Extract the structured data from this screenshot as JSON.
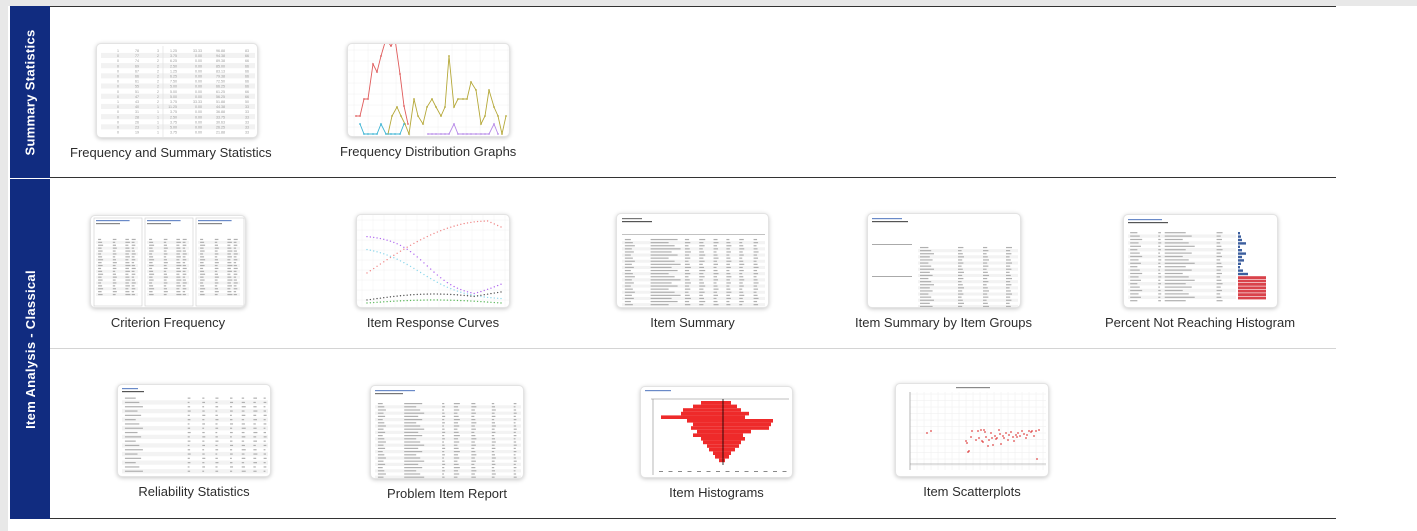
{
  "sections": [
    {
      "label": "Summary Statistics",
      "tiles": [
        {
          "label": "Frequency and Summary Statistics",
          "thumbnail": "frequency-table"
        },
        {
          "label": "Frequency Distribution Graphs",
          "thumbnail": "line-chart"
        }
      ]
    },
    {
      "label": "Item Analysis - Classical",
      "tiles": [
        {
          "label": "Criterion Frequency",
          "thumbnail": "three-panel-table"
        },
        {
          "label": "Item Response Curves",
          "thumbnail": "curve-chart"
        },
        {
          "label": "Item Summary",
          "thumbnail": "table"
        },
        {
          "label": "Item Summary by Item Groups",
          "thumbnail": "grouped-table"
        },
        {
          "label": "Percent Not Reaching Histogram",
          "thumbnail": "bar-table"
        },
        {
          "label": "Reliability Statistics",
          "thumbnail": "table"
        },
        {
          "label": "Problem Item Report",
          "thumbnail": "table"
        },
        {
          "label": "Item Histograms",
          "thumbnail": "histogram"
        },
        {
          "label": "Item Scatterplots",
          "thumbnail": "scatterplot"
        }
      ]
    }
  ],
  "thumbnails": {
    "frequency_table_rows": [
      [
        "1",
        "78",
        "3",
        "1.25",
        "33.33",
        "96.88",
        "83"
      ],
      [
        "0",
        "77",
        "2",
        "3.75",
        "0.00",
        "94.38",
        "66"
      ],
      [
        "0",
        "74",
        "2",
        "6.25",
        "0.00",
        "89.38",
        "66"
      ],
      [
        "0",
        "69",
        "2",
        "2.50",
        "0.00",
        "85.00",
        "66"
      ],
      [
        "0",
        "67",
        "2",
        "1.25",
        "0.00",
        "83.13",
        "66"
      ],
      [
        "0",
        "66",
        "2",
        "6.25",
        "0.00",
        "79.38",
        "66"
      ],
      [
        "0",
        "61",
        "2",
        "7.50",
        "0.00",
        "72.50",
        "66"
      ],
      [
        "0",
        "55",
        "2",
        "5.00",
        "0.00",
        "66.25",
        "66"
      ],
      [
        "0",
        "51",
        "2",
        "5.00",
        "0.00",
        "61.25",
        "66"
      ],
      [
        "0",
        "47",
        "2",
        "5.00",
        "0.00",
        "56.25",
        "66"
      ],
      [
        "1",
        "43",
        "2",
        "3.75",
        "33.33",
        "51.88",
        "50"
      ],
      [
        "0",
        "40",
        "1",
        "11.25",
        "0.00",
        "44.38",
        "33"
      ],
      [
        "0",
        "31",
        "1",
        "3.75",
        "0.00",
        "36.88",
        "33"
      ],
      [
        "0",
        "28",
        "1",
        "2.50",
        "0.00",
        "33.75",
        "33"
      ],
      [
        "0",
        "26",
        "1",
        "3.75",
        "0.00",
        "30.63",
        "33"
      ],
      [
        "0",
        "23",
        "1",
        "5.00",
        "0.00",
        "26.25",
        "33"
      ],
      [
        "0",
        "19",
        "1",
        "3.75",
        "0.00",
        "21.88",
        "33"
      ]
    ],
    "colors": {
      "section_label_bg": "#112c80",
      "series_red": "#e05c5c",
      "series_olive": "#b5a838",
      "series_cyan": "#3cb4d4",
      "series_purple": "#b78ae8",
      "bar_blue": "#3d5f9e",
      "bar_red": "#d9424a",
      "histogram_red": "#ee2a2a"
    }
  }
}
